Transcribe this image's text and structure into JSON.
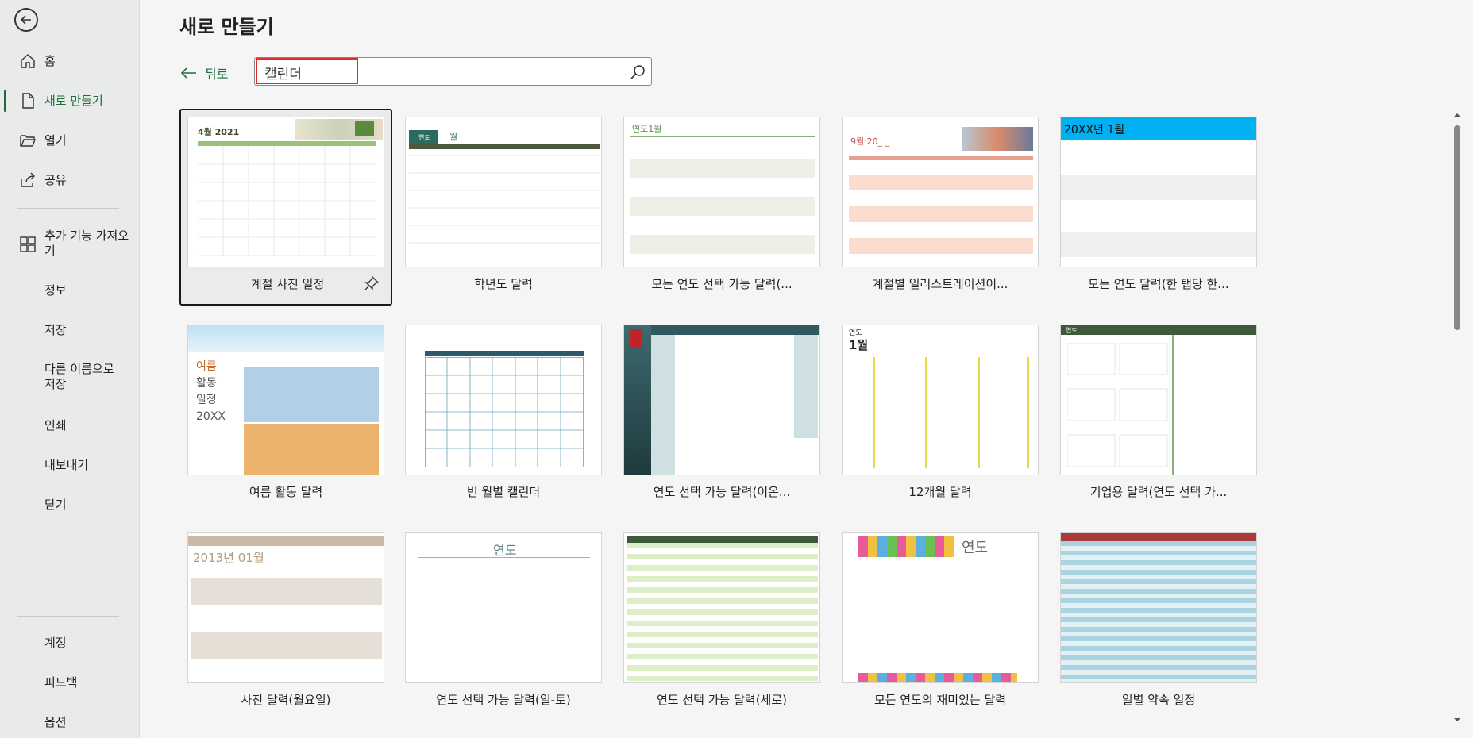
{
  "sidebar": {
    "items": [
      {
        "label": "홈",
        "icon": "home-icon"
      },
      {
        "label": "새로 만들기",
        "icon": "new-document-icon",
        "active": true
      },
      {
        "label": "열기",
        "icon": "open-folder-icon"
      },
      {
        "label": "공유",
        "icon": "share-icon"
      },
      {
        "label": "추가 기능 가져오기",
        "icon": "add-ins-icon"
      },
      {
        "label": "정보"
      },
      {
        "label": "저장"
      },
      {
        "label": "다른 이름으로 저장"
      },
      {
        "label": "인쇄"
      },
      {
        "label": "내보내기"
      },
      {
        "label": "닫기"
      },
      {
        "label": "계정"
      },
      {
        "label": "피드백"
      },
      {
        "label": "옵션"
      }
    ]
  },
  "main": {
    "title": "새로 만들기",
    "back_label": "뒤로",
    "search": {
      "value": "캘린더",
      "placeholder": ""
    }
  },
  "templates": [
    {
      "label": "계절 사진 일정",
      "selected": true
    },
    {
      "label": "학년도 달력"
    },
    {
      "label": "모든 연도 선택 가능 달력(..."
    },
    {
      "label": "계절별 일러스트레이션이..."
    },
    {
      "label": "모든 연도 달력(한 탭당 한..."
    },
    {
      "label": "여름 활동 달력"
    },
    {
      "label": "빈 월별 캘린더"
    },
    {
      "label": "연도 선택 가능 달력(이온..."
    },
    {
      "label": "12개월 달력"
    },
    {
      "label": "기업용 달력(연도 선택 가..."
    },
    {
      "label": "사진 달력(월요일)"
    },
    {
      "label": "연도 선택 가능 달력(일-토)"
    },
    {
      "label": "연도 선택 가능 달력(세로)"
    },
    {
      "label": "모든 연도의 재미있는 달력"
    },
    {
      "label": "일별 약속 일정"
    }
  ],
  "thumb_text": {
    "t1_title": "4월 2021",
    "t2_a": "연도",
    "t2_b": "월",
    "t3_title": "연도1월",
    "t4_title": "9월 20_ _",
    "t5_title": "20XX년 1월",
    "t6_lines": [
      "여름",
      "활동",
      "일정",
      "20XX"
    ],
    "t9_a": "연도",
    "t9_b": "1월",
    "t10_title": "연도",
    "t11_title": "2013년 01월",
    "t12_title": "연도",
    "t14_title": "연도"
  },
  "colors": {
    "accent": "#1e6c3b",
    "highlight": "#e12a2a",
    "t5_header": "#00b0f0"
  }
}
